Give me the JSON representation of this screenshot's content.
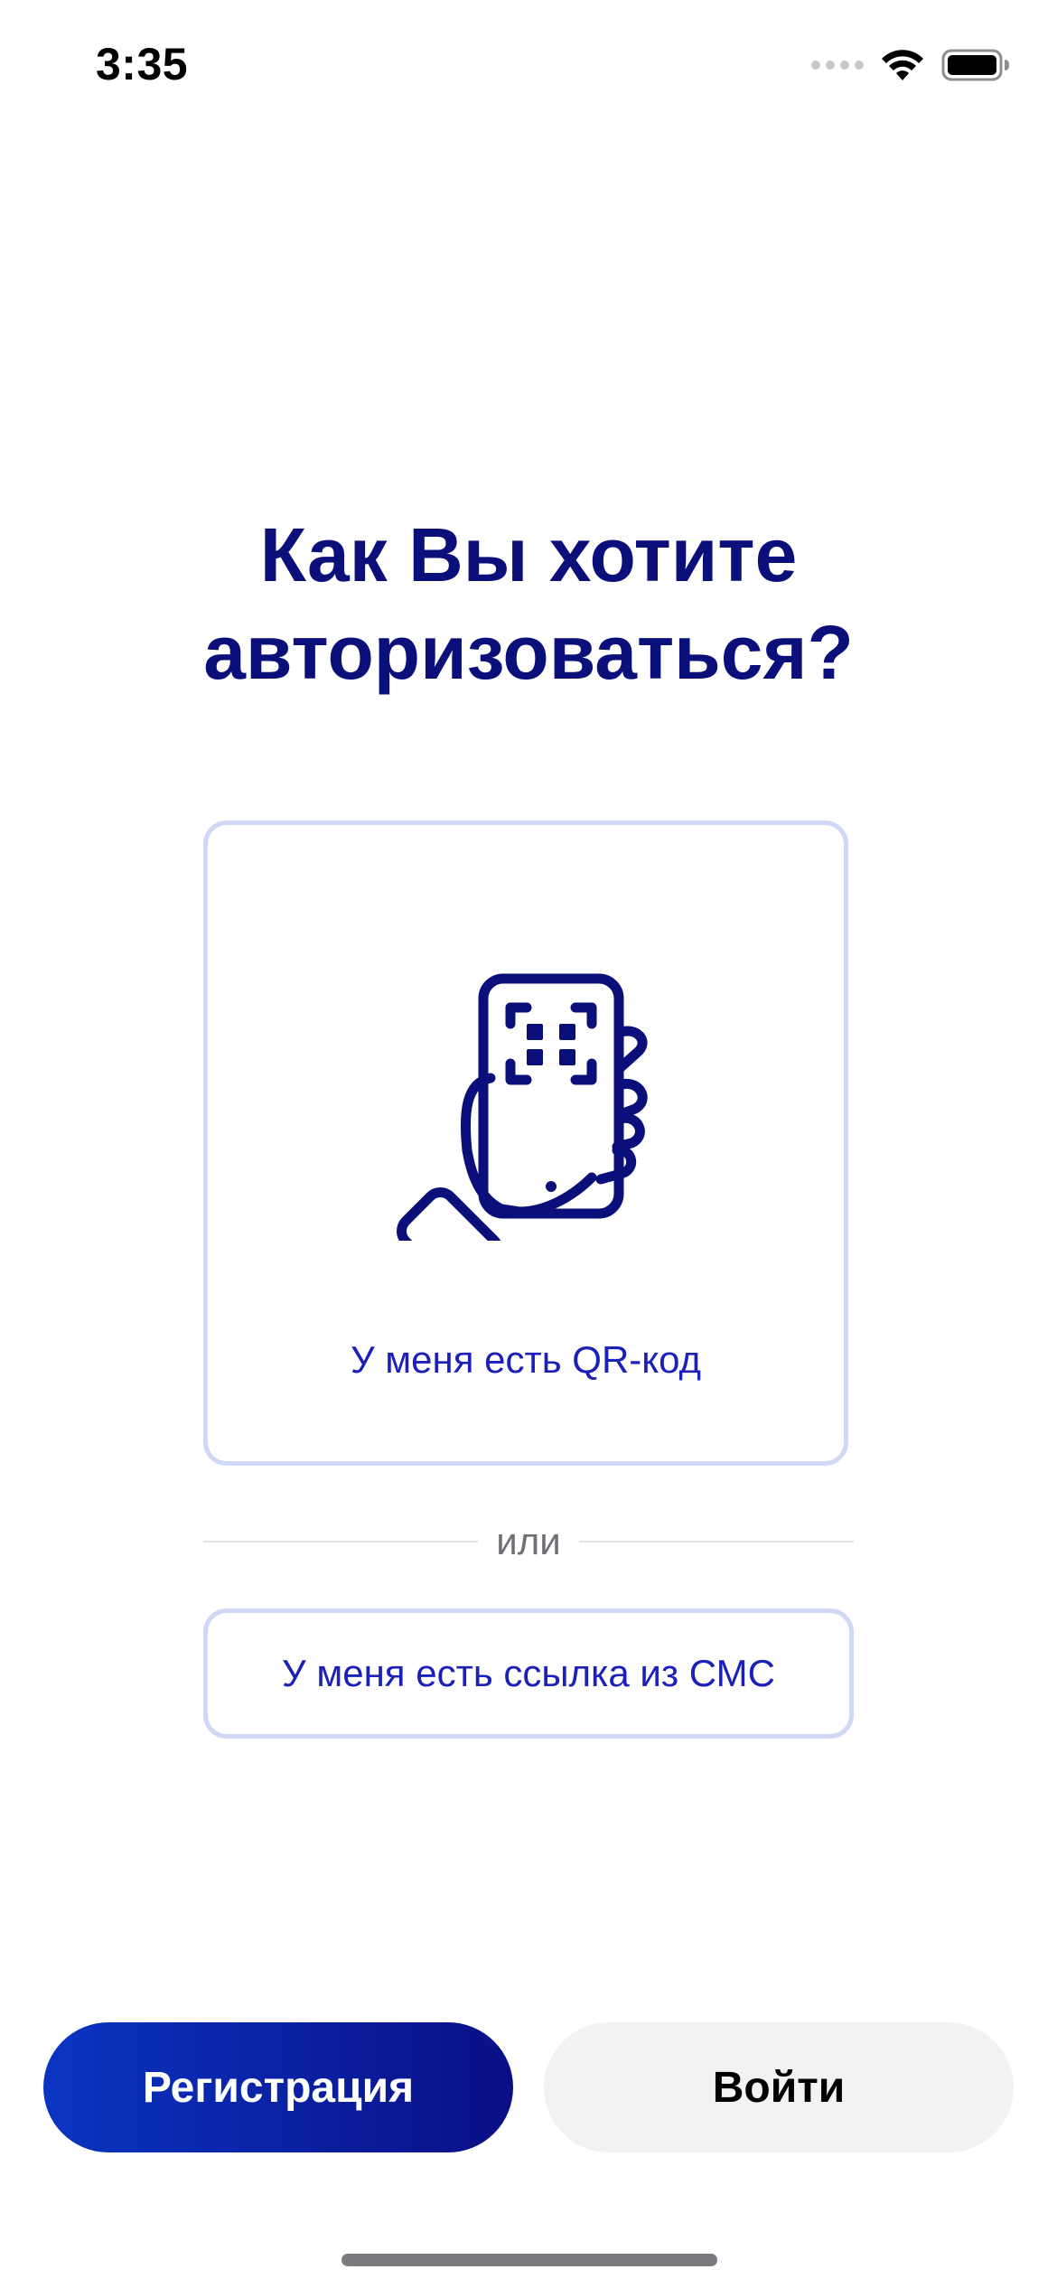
{
  "status_bar": {
    "time": "3:35",
    "icons": [
      "signal-dots-icon",
      "wifi-icon",
      "battery-icon"
    ]
  },
  "title": "Как Вы хотите\nавторизоваться?",
  "options": {
    "qr": {
      "icon": "hand-phone-qr-icon",
      "label": "У меня есть QR-код"
    },
    "divider_text": "или",
    "sms": {
      "label": "У меня есть ссылка из СМС"
    }
  },
  "buttons": {
    "register": "Регистрация",
    "login": "Войти"
  },
  "colors": {
    "primary": "#0a0f7a",
    "accent_text": "#1b20b8",
    "card_border": "#cfd9f7",
    "register_gradient_start": "#0a35c2",
    "register_gradient_end": "#0a0f86",
    "login_bg": "#f2f2f3"
  }
}
